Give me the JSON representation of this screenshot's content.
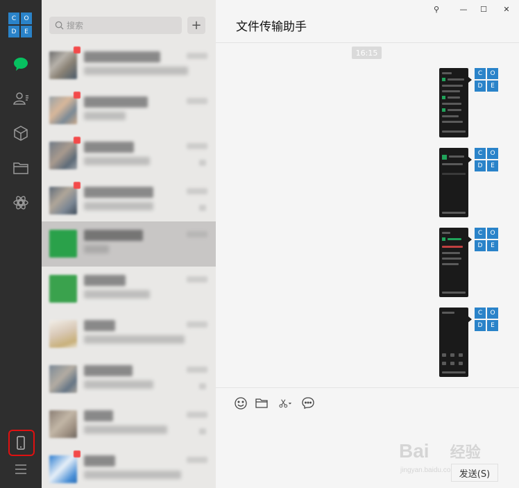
{
  "sidebar": {
    "logo_letters": [
      "C",
      "O",
      "D",
      "E"
    ],
    "icons": [
      "chat-icon",
      "contacts-icon",
      "cube-icon",
      "folder-icon",
      "discover-icon",
      "phone-icon",
      "menu-icon"
    ]
  },
  "search": {
    "placeholder": "搜索"
  },
  "add_button": "+",
  "chat": {
    "title": "文件传输助手",
    "window_buttons": [
      "⚲",
      "—",
      "☐",
      "✕"
    ],
    "time_tag": "16:15",
    "avatar_letters": [
      "C",
      "O",
      "D",
      "E"
    ],
    "send_label": "发送(S)"
  },
  "watermark": {
    "brand": "Bai",
    "brand2": "经验",
    "sub": "jingyan.baidu.com"
  },
  "colors": {
    "rail": "#2e2e2e",
    "list_bg": "#e9e8e6",
    "chat_bg": "#f5f5f5",
    "accent_green": "#07c160",
    "logo_blue": "#2a83c9",
    "highlight_red": "#e01010"
  }
}
